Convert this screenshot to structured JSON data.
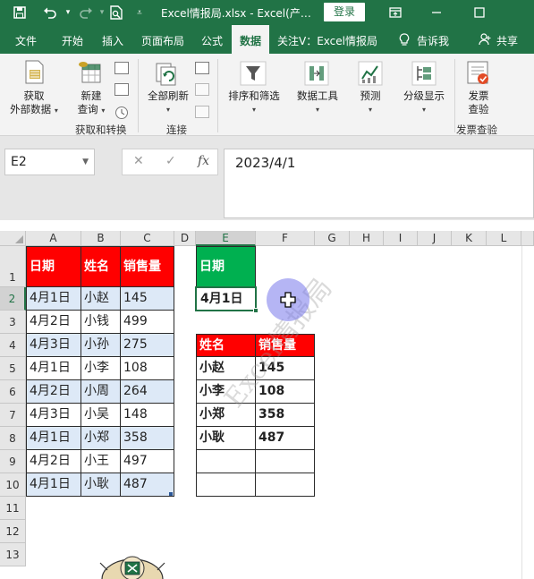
{
  "titlebar": {
    "title": "Excel情报局.xlsx  -  Excel(产…",
    "login_label": "登录",
    "icons": [
      "save-icon",
      "undo-icon",
      "redo-icon",
      "print-preview-icon",
      "customize-icon",
      "restore-icon",
      "minimize-icon",
      "maximize-icon"
    ]
  },
  "menu": {
    "items": [
      {
        "label": "文件"
      },
      {
        "label": "开始"
      },
      {
        "label": "插入"
      },
      {
        "label": "页面布局"
      },
      {
        "label": "公式"
      },
      {
        "label": "数据",
        "active": true
      },
      {
        "label": "关注V：Excel情报局"
      },
      {
        "label": "告诉我"
      },
      {
        "label": "共享"
      }
    ]
  },
  "ribbon": {
    "get_data_line1": "获取",
    "get_data_line2": "外部数据",
    "new_query_line1": "新建",
    "new_query_line2": "查询",
    "group_get_transform": "获取和转换",
    "refresh_all": "全部刷新",
    "group_connections": "连接",
    "sort_filter": "排序和筛选",
    "data_tools": "数据工具",
    "forecast": "预测",
    "outline": "分级显示",
    "invoice_line1": "发票",
    "invoice_line2": "查验",
    "group_invoice": "发票查验"
  },
  "formula_bar": {
    "name_box": "E2",
    "formula": "2023/4/1"
  },
  "sheet": {
    "columns": [
      "A",
      "B",
      "C",
      "D",
      "E",
      "F",
      "G",
      "H",
      "I",
      "J",
      "K",
      "L"
    ],
    "rows": [
      "1",
      "2",
      "3",
      "4",
      "5",
      "6",
      "7",
      "8",
      "9",
      "10",
      "11",
      "12",
      "13"
    ],
    "main_table": {
      "headers": [
        "日期",
        "姓名",
        "销售量"
      ],
      "rows": [
        [
          "4月1日",
          "小赵",
          "145"
        ],
        [
          "4月2日",
          "小钱",
          "499"
        ],
        [
          "4月3日",
          "小孙",
          "275"
        ],
        [
          "4月1日",
          "小李",
          "108"
        ],
        [
          "4月2日",
          "小周",
          "264"
        ],
        [
          "4月3日",
          "小吴",
          "148"
        ],
        [
          "4月1日",
          "小郑",
          "358"
        ],
        [
          "4月2日",
          "小王",
          "497"
        ],
        [
          "4月1日",
          "小耿",
          "487"
        ]
      ]
    },
    "criteria": {
      "header": "日期",
      "value": "4月1日"
    },
    "result_table": {
      "headers": [
        "姓名",
        "销售量"
      ],
      "rows": [
        [
          "小赵",
          "145"
        ],
        [
          "小李",
          "108"
        ],
        [
          "小郑",
          "358"
        ],
        [
          "小耿",
          "487"
        ],
        [
          "",
          ""
        ],
        [
          "",
          ""
        ]
      ]
    },
    "watermark": "Excel情报局"
  },
  "colors": {
    "excel_green": "#217346",
    "header_red": "#ff0000",
    "header_green": "#00b050",
    "band_blue": "#dde9f7"
  }
}
